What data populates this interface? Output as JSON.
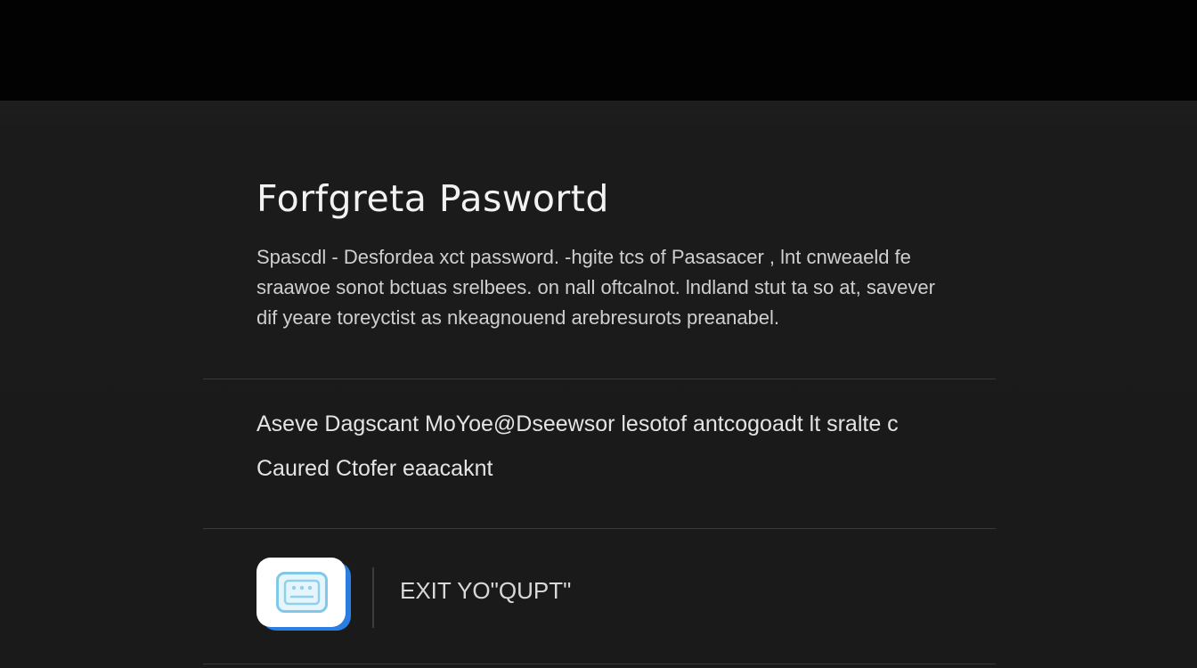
{
  "header": {},
  "page": {
    "title": "Forfgreta Paswortd",
    "description_lines": [
      "Spascdl - Desfordea xct password.     -hgite tcs of Pasasacer , lnt cnweaeld fe",
      "sraawoe sonot bctuas srelbees. on nall oftcalnot. lndland stut ta so at, savever",
      "dif yeare toreyctist as nkeagnouend arebresurots preanabel."
    ]
  },
  "options": {
    "line1": "Aseve Dagscant  MoYoe@Dseewsor lesotof  antcogoadt lt sralte c",
    "line2": "Caured  Ctofer eaacaknt"
  },
  "footer": {
    "app_icon": "app-window-icon",
    "exit_label": "EXIT YO\"QUPT\""
  },
  "colors": {
    "top_bar": "#020202",
    "background": "#1b1b1b",
    "title": "#f2f2f2",
    "text": "#cfcfcf",
    "divider": "#3a3a3a",
    "icon_accent": "#2a7de1",
    "icon_inner": "#7fc8e8"
  }
}
